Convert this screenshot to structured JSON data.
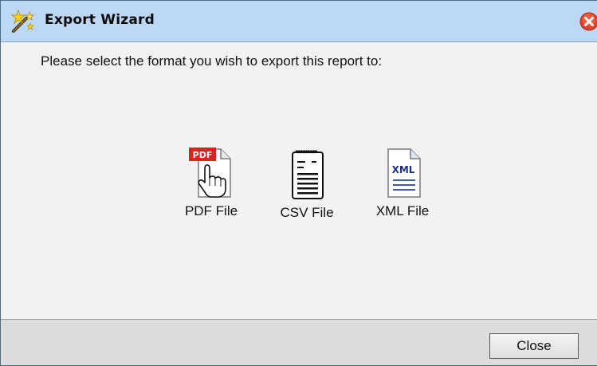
{
  "window": {
    "title": "Export Wizard",
    "title_icon": "magic-wand-icon",
    "close_icon": "close-circle-icon"
  },
  "main": {
    "instruction": "Please select the format you wish to export this report to:",
    "formats": [
      {
        "label": "PDF File",
        "icon": "pdf-file-icon"
      },
      {
        "label": "CSV File",
        "icon": "csv-file-icon"
      },
      {
        "label": "XML File",
        "icon": "xml-file-icon"
      }
    ]
  },
  "footer": {
    "close_label": "Close"
  },
  "colors": {
    "titlebar": "#bcd8f4",
    "body": "#f2f2f2",
    "footer": "#dcdcdc",
    "close_icon": "#e0452a",
    "pdf_badge": "#e01f1f",
    "xml_text": "#1a2f8a"
  }
}
